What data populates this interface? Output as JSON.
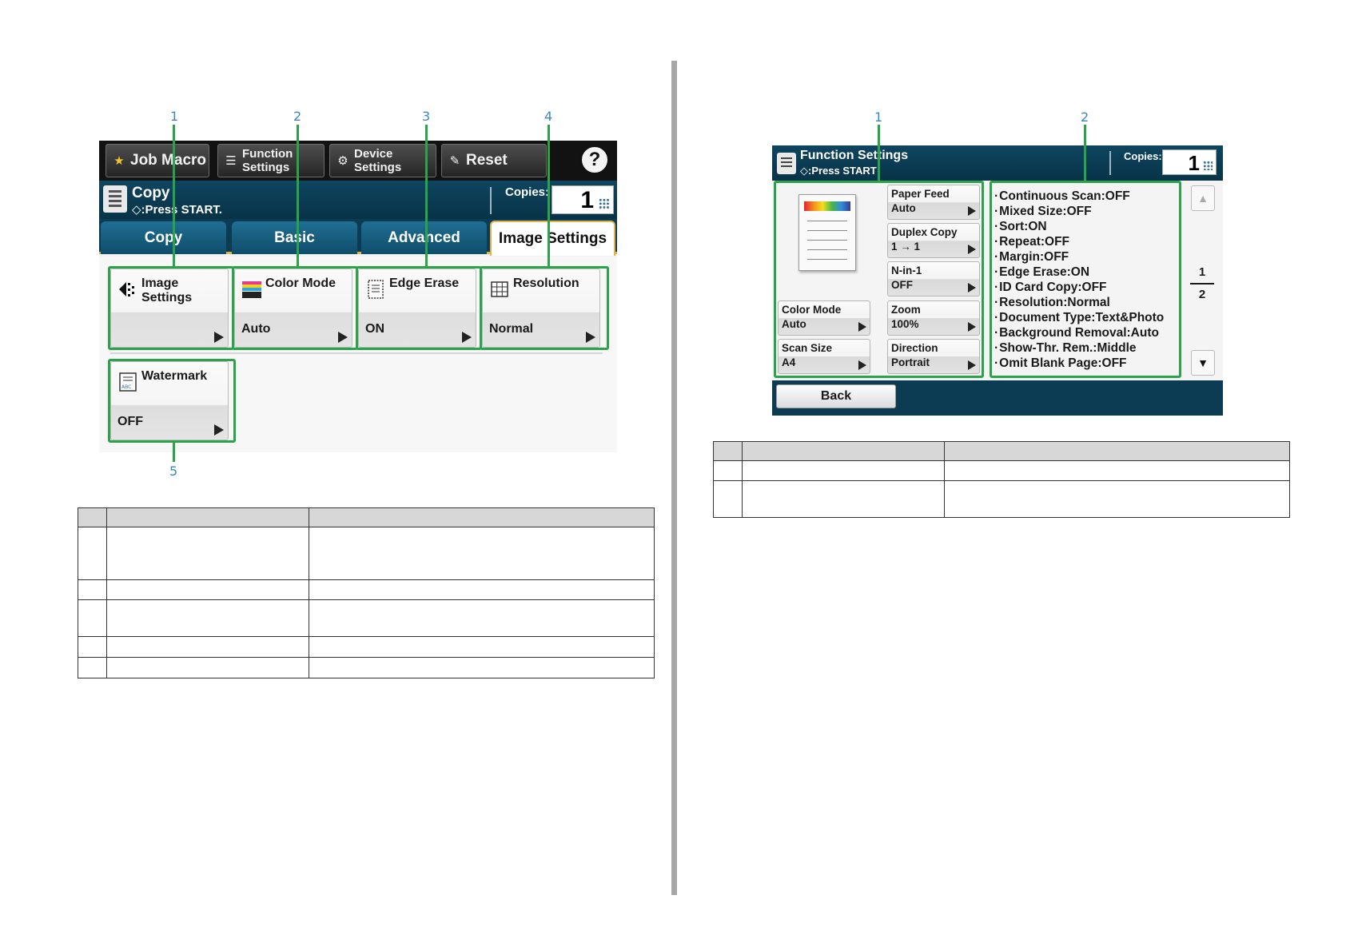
{
  "left_screen": {
    "topbar": [
      {
        "label": "Job Macro",
        "icon": "star-icon"
      },
      {
        "label": "Function\nSettings",
        "icon": "list-icon"
      },
      {
        "label": "Device\nSettings",
        "icon": "gear-icon"
      },
      {
        "label": "Reset",
        "icon": "pencil-slash-icon"
      }
    ],
    "help_label": "?",
    "header": {
      "title": "Copy",
      "subtitle": "◇:Press START.",
      "copies_label": "Copies:",
      "copies_value": "1"
    },
    "tabs": [
      "Copy",
      "Basic",
      "Advanced",
      "Image Settings"
    ],
    "active_tab": "Image Settings",
    "buttons": [
      {
        "title": "Image\nSettings",
        "value": "",
        "icon": "image-settings-icon"
      },
      {
        "title": "Color Mode",
        "value": "Auto",
        "icon": "color-mode-icon"
      },
      {
        "title": "Edge Erase",
        "value": "ON",
        "icon": "edge-erase-icon"
      },
      {
        "title": "Resolution",
        "value": "Normal",
        "icon": "grid-icon"
      },
      {
        "title": "Watermark",
        "value": "OFF",
        "icon": "watermark-icon"
      }
    ],
    "callouts": [
      "1",
      "2",
      "3",
      "4",
      "5"
    ]
  },
  "right_screen": {
    "header": {
      "title": "Function Settings",
      "subtitle": "◇:Press START",
      "copies_label": "Copies:",
      "copies_value": "1"
    },
    "buttons_left": [
      {
        "title": "Color Mode",
        "value": "Auto"
      },
      {
        "title": "Scan Size",
        "value": "A4"
      }
    ],
    "buttons_mid": [
      {
        "title": "Paper Feed",
        "value": "Auto"
      },
      {
        "title": "Duplex Copy",
        "value": "1 → 1"
      },
      {
        "title": "N-in-1",
        "value": "OFF"
      },
      {
        "title": "Zoom",
        "value": "100%"
      },
      {
        "title": "Direction",
        "value": "Portrait"
      }
    ],
    "summary": [
      "Continuous Scan:OFF",
      "Mixed Size:OFF",
      "Sort:ON",
      "Repeat:OFF",
      "Margin:OFF",
      "Edge Erase:ON",
      "ID Card Copy:OFF",
      "Resolution:Normal",
      "Document Type:Text&Photo",
      "Background Removal:Auto",
      "Show-Thr. Rem.:Middle",
      "Omit Blank Page:OFF"
    ],
    "page": {
      "current": "1",
      "total": "2"
    },
    "scroll_up": "▲",
    "scroll_down": "▼",
    "back_label": "Back",
    "callouts": [
      "1",
      "2"
    ]
  },
  "colors": {
    "callout_line": "#2aa34a",
    "callout_number": "#3a86c5",
    "header": "#0b3c53",
    "tab_accent": "#e3b34a"
  }
}
